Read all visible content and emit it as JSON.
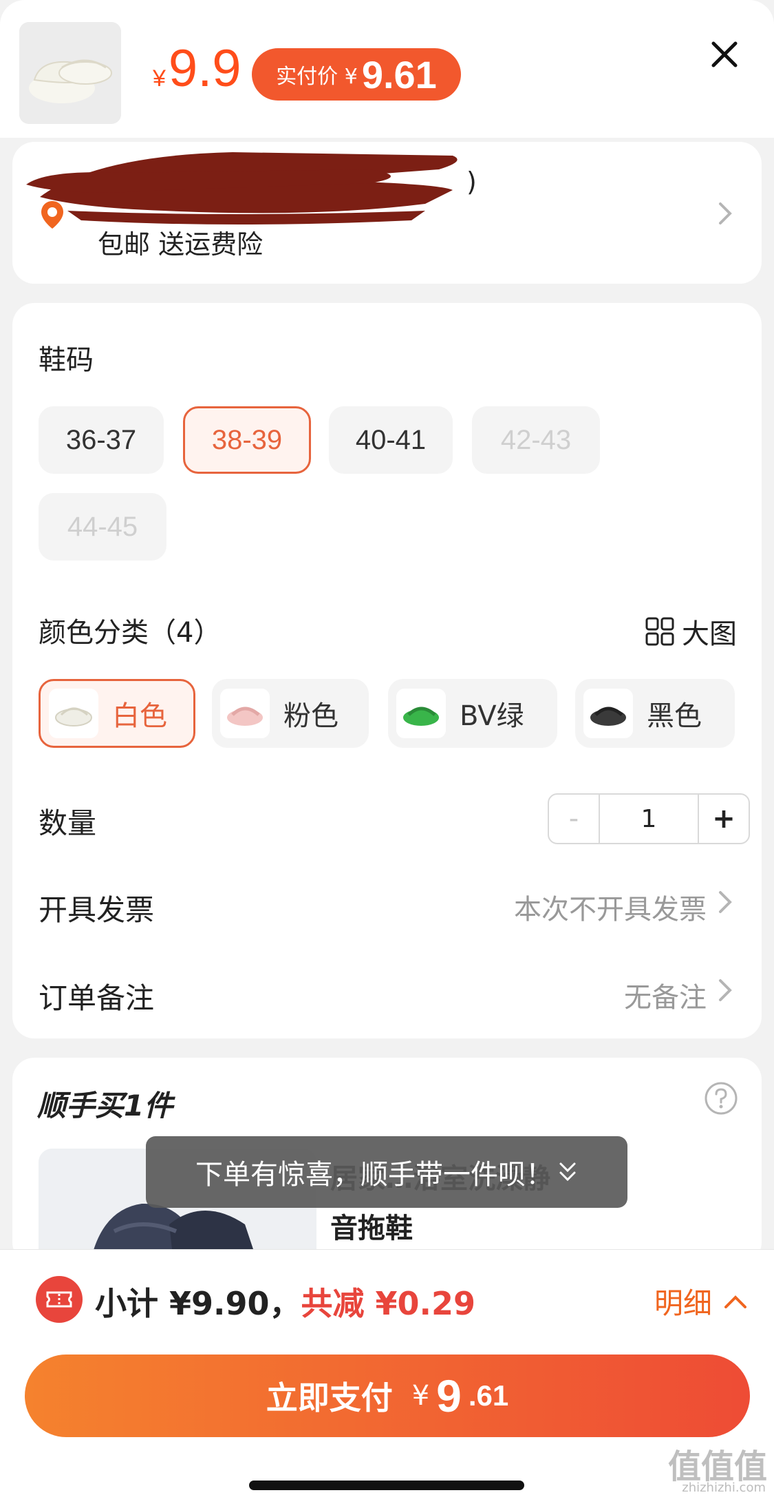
{
  "header": {
    "price_symbol": "¥",
    "price": "9.9",
    "pay_label": "实付价 ¥",
    "pay_value": "9.61"
  },
  "address": {
    "partial_text": ")",
    "shipping": "包邮  送运费险"
  },
  "size": {
    "title": "鞋码",
    "options": [
      {
        "label": "36-37",
        "state": "normal"
      },
      {
        "label": "38-39",
        "state": "selected"
      },
      {
        "label": "40-41",
        "state": "normal"
      },
      {
        "label": "42-43",
        "state": "disabled"
      },
      {
        "label": "44-45",
        "state": "disabled"
      }
    ]
  },
  "color": {
    "title": "颜色分类（4）",
    "big_pic_label": "大图",
    "options": [
      {
        "label": "白色",
        "swatch": "#efeee6",
        "state": "selected"
      },
      {
        "label": "粉色",
        "swatch": "#f3c6c4",
        "state": "normal"
      },
      {
        "label": "BV绿",
        "swatch": "#39b54a",
        "state": "normal"
      },
      {
        "label": "黑色",
        "swatch": "#3a3a3a",
        "state": "normal"
      }
    ]
  },
  "quantity": {
    "label": "数量",
    "minus": "-",
    "value": "1",
    "plus": "+"
  },
  "invoice": {
    "label": "开具发票",
    "value": "本次不开具发票"
  },
  "note": {
    "label": "订单备注",
    "value": "无备注"
  },
  "add_on": {
    "title": "顺手买1件",
    "product_name_line1": "居家…浴室洗澡静",
    "product_name_line2": "音拖鞋"
  },
  "toast": "下单有惊喜，顺手带一件呗！",
  "footer": {
    "subtotal_prefix": "小计 ¥9.90，",
    "discount": "共减 ¥0.29",
    "detail_label": "明细",
    "pay_label": "立即支付",
    "pay_symbol": "¥",
    "pay_int": "9",
    "pay_dec": ".61"
  },
  "watermark": {
    "main": "值值值",
    "sub": "zhizhizhi.com"
  },
  "colors": {
    "accent": "#e7643d",
    "price_red": "#ff4d1a",
    "pay_gradient_start": "#f5822e",
    "pay_gradient_end": "#ee4c35"
  }
}
